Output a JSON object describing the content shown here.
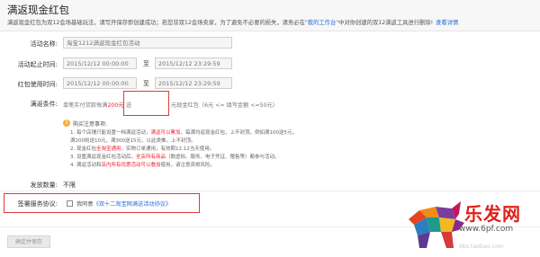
{
  "header": {
    "title": "满返现金红包",
    "desc_pre": "满返现金红包为双12会场基础玩法，请写开保存即创建成功；若您非双12会场卖家，为了避免不必要的损失，请务必在",
    "desc_link": "\"我的工作台\"",
    "desc_post": "中对你创建的双12满返工具进行删除!",
    "detail_link": "查看详情"
  },
  "form": {
    "activity_name_label": "活动名称:",
    "activity_name_value": "淘宝1212满返现金红包活动",
    "activity_time_label": "活动起止时间:",
    "activity_start": "2015/12/12 00:00:00",
    "activity_end": "2015/12/12 23:29:59",
    "to": "至",
    "redpack_time_label": "红包使用时间:",
    "redpack_start": "2015/12/12 00:00:00",
    "redpack_end": "2015/12/12 23:29:59",
    "condition_label": "满返条件:",
    "condition_pre": "单笔实付贷款每满",
    "condition_amount": "200元",
    "condition_input": "送",
    "condition_post": "元现金红包（6元 <= 填写金额 <=50元）",
    "issue_label": "发放数量:",
    "issue_value": "不限",
    "agreement_label": "签署服务协议:",
    "agreement_text": "我同意",
    "agreement_link": "《双十二淘宝网满送活动协议》",
    "submit_label": "确定并保存"
  },
  "notes": {
    "title": "购买注意事项:",
    "lines": [
      {
        "pre": "1. 每个店铺只能设置一档满返活动，",
        "red": "满返可以累加",
        "post": "，每满均返现金红包，上不封顶。例如满100送5元，"
      },
      {
        "pre": "   满200则送10元，满300送15元，以此类推，上不封顶。",
        "red": "",
        "post": ""
      },
      {
        "pre": "2. 现金红包",
        "red": "全淘宝通用",
        "post": "，实物订单通用，有效期12.12当天使用。"
      },
      {
        "pre": "3. 设置满返现金红包活动后，",
        "red": "全店所有商品",
        "post": "（数虚拟、服务、电子凭证、赠售等）都参与活动。"
      },
      {
        "pre": "4. 满返活动和",
        "red": "店内所有优惠活动可以叠加",
        "post": "使用，请注意资损风险。"
      }
    ]
  },
  "logo": {
    "text": "乐发网",
    "url": "www.6pf.com"
  },
  "watermark": "bbs.taobao.com"
}
